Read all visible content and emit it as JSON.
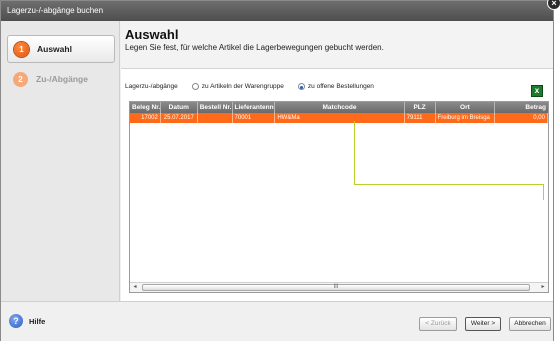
{
  "window": {
    "title": "Lagerzu-/-abgänge buchen",
    "close_glyph": "×"
  },
  "sidebar": {
    "steps": [
      {
        "num": "1",
        "label": "Auswahl"
      },
      {
        "num": "2",
        "label": "Zu-/Abgänge"
      }
    ]
  },
  "header": {
    "title": "Auswahl",
    "subtitle": "Legen Sie fest, für welche Artikel die Lagerbewegungen gebucht werden."
  },
  "filter": {
    "label": "Lagerzu-/abgänge",
    "options": [
      {
        "label": "zu Artikeln der Warengruppe",
        "checked": false
      },
      {
        "label": "zu offene Bestellungen",
        "checked": true
      }
    ],
    "export_icon": "excel-icon"
  },
  "grid": {
    "columns": [
      "Beleg Nr.",
      "Datum",
      "Bestell Nr.",
      "Lieferantennr.",
      "Matchcode",
      "PLZ",
      "Ort",
      "Betrag"
    ],
    "rows": [
      [
        "17002",
        "25.07.2017",
        "",
        "70001",
        "HW&Ma",
        "79111",
        "Freiburg im Breisga",
        "0,00"
      ]
    ],
    "scroll_mark": "III",
    "left_arrow": "◂",
    "right_arrow": "▸"
  },
  "footer": {
    "help_label": "Hilfe",
    "help_glyph": "?",
    "back_label": "< Zurück",
    "next_label": "Weiter >",
    "cancel_label": "Abbrechen"
  },
  "colors": {
    "accent": "#ff6a1a",
    "annotation": "#b5d12a",
    "titlebar": "#5a5a5a"
  }
}
